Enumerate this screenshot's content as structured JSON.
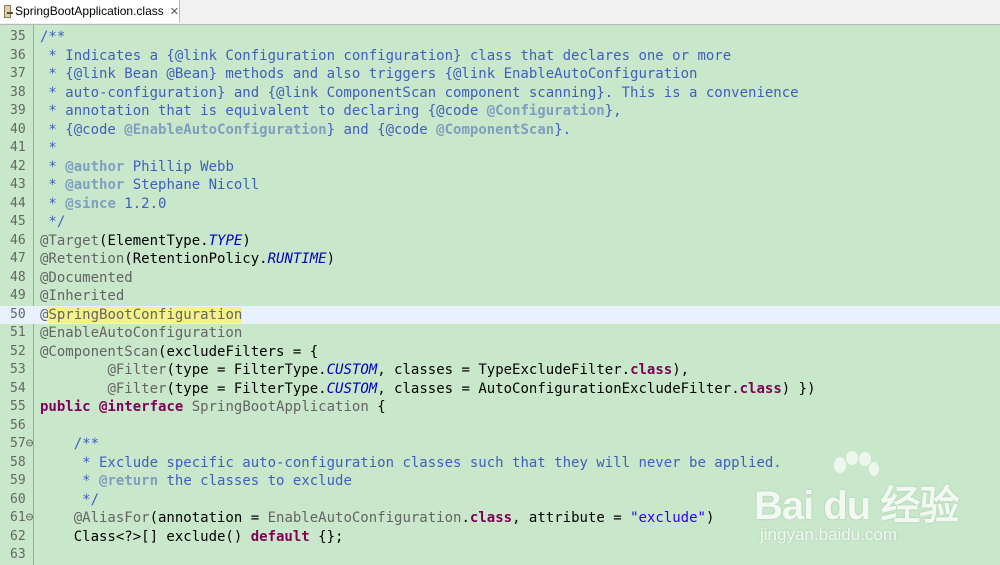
{
  "tab": {
    "label": "SpringBootApplication.class",
    "close": "✕"
  },
  "editor": {
    "current_line": 50,
    "lines": [
      {
        "n": "35",
        "tokens": [
          [
            "jd",
            "/**"
          ]
        ]
      },
      {
        "n": "36",
        "tokens": [
          [
            "jd",
            " * Indicates a {@link Configuration configuration} class that declares one or more"
          ]
        ]
      },
      {
        "n": "37",
        "tokens": [
          [
            "jd",
            " * {@link Bean @Bean} methods and also triggers {@link EnableAutoConfiguration"
          ]
        ]
      },
      {
        "n": "38",
        "tokens": [
          [
            "jd",
            " * auto-configuration} and {@link ComponentScan component scanning}. This is a convenience"
          ]
        ]
      },
      {
        "n": "39",
        "tokens": [
          [
            "jd",
            " * annotation that is equivalent to declaring {@code "
          ],
          [
            "tag",
            "@Configuration"
          ],
          [
            "jd",
            "},"
          ]
        ]
      },
      {
        "n": "40",
        "tokens": [
          [
            "jd",
            " * {@code "
          ],
          [
            "tag",
            "@EnableAutoConfiguration"
          ],
          [
            "jd",
            "} and {@code "
          ],
          [
            "tag",
            "@ComponentScan"
          ],
          [
            "jd",
            "}."
          ]
        ]
      },
      {
        "n": "41",
        "tokens": [
          [
            "jd",
            " *"
          ]
        ]
      },
      {
        "n": "42",
        "tokens": [
          [
            "jd",
            " * "
          ],
          [
            "tag",
            "@author"
          ],
          [
            "jd",
            " Phillip Webb"
          ]
        ]
      },
      {
        "n": "43",
        "tokens": [
          [
            "jd",
            " * "
          ],
          [
            "tag",
            "@author"
          ],
          [
            "jd",
            " Stephane Nicoll"
          ]
        ]
      },
      {
        "n": "44",
        "tokens": [
          [
            "jd",
            " * "
          ],
          [
            "tag",
            "@since"
          ],
          [
            "jd",
            " 1.2.0"
          ]
        ]
      },
      {
        "n": "45",
        "tokens": [
          [
            "jd",
            " */"
          ]
        ]
      },
      {
        "n": "46",
        "tokens": [
          [
            "ann",
            "@Target"
          ],
          [
            "plain",
            "(ElementType."
          ],
          [
            "const",
            "TYPE"
          ],
          [
            "plain",
            ")"
          ]
        ]
      },
      {
        "n": "47",
        "tokens": [
          [
            "ann",
            "@Retention"
          ],
          [
            "plain",
            "(RetentionPolicy."
          ],
          [
            "const",
            "RUNTIME"
          ],
          [
            "plain",
            ")"
          ]
        ]
      },
      {
        "n": "48",
        "tokens": [
          [
            "ann",
            "@Documented"
          ]
        ]
      },
      {
        "n": "49",
        "tokens": [
          [
            "ann",
            "@Inherited"
          ]
        ]
      },
      {
        "n": "50",
        "tokens": [
          [
            "ann",
            "@"
          ],
          [
            "occ",
            "SpringBootConfiguration"
          ]
        ]
      },
      {
        "n": "51",
        "tokens": [
          [
            "ann",
            "@EnableAutoConfiguration"
          ]
        ]
      },
      {
        "n": "52",
        "tokens": [
          [
            "ann",
            "@ComponentScan"
          ],
          [
            "plain",
            "(excludeFilters = {"
          ]
        ]
      },
      {
        "n": "53",
        "tokens": [
          [
            "plain",
            "        "
          ],
          [
            "ann",
            "@Filter"
          ],
          [
            "plain",
            "(type = FilterType."
          ],
          [
            "const",
            "CUSTOM"
          ],
          [
            "plain",
            ", classes = TypeExcludeFilter."
          ],
          [
            "kw",
            "class"
          ],
          [
            "plain",
            "),"
          ]
        ]
      },
      {
        "n": "54",
        "tokens": [
          [
            "plain",
            "        "
          ],
          [
            "ann",
            "@Filter"
          ],
          [
            "plain",
            "(type = FilterType."
          ],
          [
            "const",
            "CUSTOM"
          ],
          [
            "plain",
            ", classes = AutoConfigurationExcludeFilter."
          ],
          [
            "kw",
            "class"
          ],
          [
            "plain",
            ") })"
          ]
        ]
      },
      {
        "n": "55",
        "tokens": [
          [
            "kw",
            "public"
          ],
          [
            "plain",
            " "
          ],
          [
            "kw",
            "@interface"
          ],
          [
            "plain",
            " "
          ],
          [
            "ann",
            "SpringBootApplication"
          ],
          [
            "plain",
            " {"
          ]
        ]
      },
      {
        "n": "56",
        "tokens": []
      },
      {
        "n": "57⊖",
        "tokens": [
          [
            "plain",
            "    "
          ],
          [
            "jd",
            "/**"
          ]
        ]
      },
      {
        "n": "58",
        "tokens": [
          [
            "plain",
            "    "
          ],
          [
            "jd",
            " * Exclude specific auto-configuration classes such that they will never be applied."
          ]
        ]
      },
      {
        "n": "59",
        "tokens": [
          [
            "plain",
            "    "
          ],
          [
            "jd",
            " * "
          ],
          [
            "tag",
            "@return"
          ],
          [
            "jd",
            " the classes to exclude"
          ]
        ]
      },
      {
        "n": "60",
        "tokens": [
          [
            "plain",
            "    "
          ],
          [
            "jd",
            " */"
          ]
        ]
      },
      {
        "n": "61⊖",
        "tokens": [
          [
            "plain",
            "    "
          ],
          [
            "ann",
            "@AliasFor"
          ],
          [
            "plain",
            "(annotation = "
          ],
          [
            "ann",
            "EnableAutoConfiguration"
          ],
          [
            "plain",
            "."
          ],
          [
            "kw",
            "class"
          ],
          [
            "plain",
            ", attribute = "
          ],
          [
            "str",
            "\"exclude\""
          ],
          [
            "plain",
            ")"
          ]
        ]
      },
      {
        "n": "62",
        "tokens": [
          [
            "plain",
            "    Class<?>[] exclude() "
          ],
          [
            "kw",
            "default"
          ],
          [
            "plain",
            " {};"
          ]
        ]
      },
      {
        "n": "63",
        "tokens": []
      }
    ]
  },
  "watermark": {
    "logo": "Bai du 经验",
    "sub": "jingyan.baidu.com"
  }
}
